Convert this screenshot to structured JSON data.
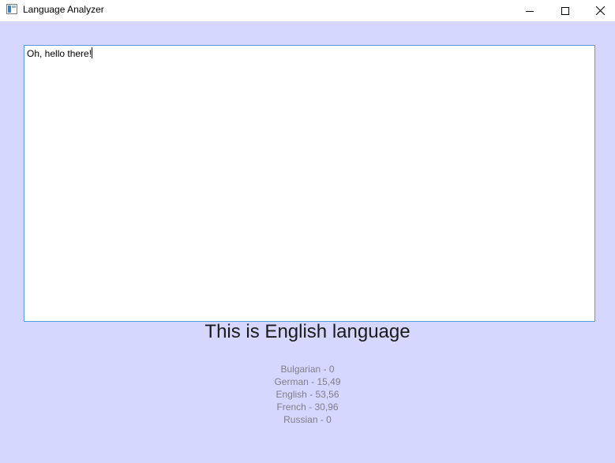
{
  "window": {
    "title": "Language Analyzer"
  },
  "input": {
    "text": "Oh, hello there!"
  },
  "result": {
    "text": "This is English language"
  },
  "scores": [
    {
      "text": "Bulgarian - 0"
    },
    {
      "text": "German - 15,49"
    },
    {
      "text": "English - 53,56"
    },
    {
      "text": "French - 30,96"
    },
    {
      "text": "Russian - 0"
    }
  ],
  "colors": {
    "background": "#d6d7ff",
    "accent": "#5b9bd5"
  },
  "icons": [
    "app-icon",
    "minimize-icon",
    "maximize-icon",
    "close-icon"
  ]
}
